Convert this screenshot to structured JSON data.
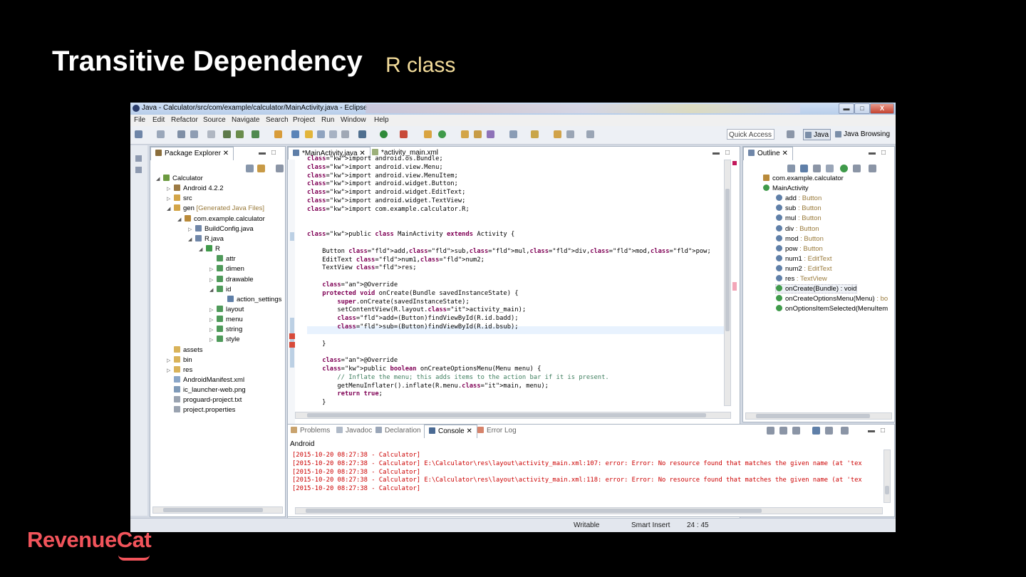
{
  "slide": {
    "title": "Transitive Dependency",
    "subtitle": "R class",
    "brand": "RevenueCat"
  },
  "window": {
    "title": "Java - Calculator/src/com/example/calculator/MainActivity.java - Eclipse",
    "buttons": {
      "minimize": "▬",
      "maximize": "□",
      "close": "X"
    }
  },
  "menu": [
    "File",
    "Edit",
    "Refactor",
    "Source",
    "Navigate",
    "Search",
    "Project",
    "Run",
    "Window",
    "Help"
  ],
  "toolbar": {
    "quick_access": "Quick Access",
    "perspectives": [
      "Java",
      "Java Browsing"
    ]
  },
  "package_explorer": {
    "tab": "Package Explorer",
    "items": [
      {
        "label": "Calculator",
        "icon": "project-icon"
      },
      {
        "label": "Android 4.2.2",
        "icon": "library-icon"
      },
      {
        "label": "src",
        "icon": "source-folder-icon"
      },
      {
        "label": "gen",
        "suffix": "[Generated Java Files]",
        "icon": "source-folder-icon"
      },
      {
        "label": "com.example.calculator",
        "icon": "package-icon"
      },
      {
        "label": "BuildConfig.java",
        "icon": "java-file-icon"
      },
      {
        "label": "R.java",
        "icon": "java-file-icon"
      },
      {
        "label": "R",
        "icon": "class-icon"
      },
      {
        "label": "attr",
        "icon": "inner-class-icon"
      },
      {
        "label": "dimen",
        "icon": "inner-class-icon"
      },
      {
        "label": "drawable",
        "icon": "inner-class-icon"
      },
      {
        "label": "id",
        "icon": "inner-class-icon"
      },
      {
        "label": "action_settings",
        "icon": "field-icon"
      },
      {
        "label": "layout",
        "icon": "inner-class-icon"
      },
      {
        "label": "menu",
        "icon": "inner-class-icon"
      },
      {
        "label": "string",
        "icon": "inner-class-icon"
      },
      {
        "label": "style",
        "icon": "inner-class-icon"
      },
      {
        "label": "assets",
        "icon": "folder-icon"
      },
      {
        "label": "bin",
        "icon": "folder-icon"
      },
      {
        "label": "res",
        "icon": "folder-icon"
      },
      {
        "label": "AndroidManifest.xml",
        "icon": "xml-file-icon"
      },
      {
        "label": "ic_launcher-web.png",
        "icon": "image-file-icon"
      },
      {
        "label": "proguard-project.txt",
        "icon": "text-file-icon"
      },
      {
        "label": "project.properties",
        "icon": "text-file-icon"
      }
    ]
  },
  "editor": {
    "tabs": [
      "*MainActivity.java",
      "*activity_main.xml"
    ],
    "lines": [
      "import android.os.Bundle;",
      "import android.view.Menu;",
      "import android.view.MenuItem;",
      "import android.widget.Button;",
      "import android.widget.EditText;",
      "import android.widget.TextView;",
      "import com.example.calculator.R;",
      "",
      "",
      "public class MainActivity extends Activity {",
      "",
      "    Button add,sub,mul,div,mod,pow;",
      "    EditText num1,num2;",
      "    TextView res;",
      "",
      "    @Override",
      "    protected void onCreate(Bundle savedInstanceState) {",
      "        super.onCreate(savedInstanceState);",
      "        setContentView(R.layout.activity_main);",
      "        add=(Button)findViewById(R.id.badd);",
      "        sub=(Button)findViewById(R.id.bsub);",
      "",
      "    }",
      "",
      "    @Override",
      "    public boolean onCreateOptionsMenu(Menu menu) {",
      "        // Inflate the menu; this adds items to the action bar if it is present.",
      "        getMenuInflater().inflate(R.menu.main, menu);",
      "        return true;",
      "    }"
    ]
  },
  "outline": {
    "tab": "Outline",
    "items": [
      {
        "name": "com.example.calculator",
        "type": ""
      },
      {
        "name": "MainActivity",
        "type": ""
      },
      {
        "name": "add",
        "type": " : Button"
      },
      {
        "name": "sub",
        "type": " : Button"
      },
      {
        "name": "mul",
        "type": " : Button"
      },
      {
        "name": "div",
        "type": " : Button"
      },
      {
        "name": "mod",
        "type": " : Button"
      },
      {
        "name": "pow",
        "type": " : Button"
      },
      {
        "name": "num1",
        "type": " : EditText"
      },
      {
        "name": "num2",
        "type": " : EditText"
      },
      {
        "name": "res",
        "type": " : TextView"
      },
      {
        "name": "onCreate(Bundle) : void",
        "type": ""
      },
      {
        "name": "onCreateOptionsMenu(Menu)",
        "type": " : bo"
      },
      {
        "name": "onOptionsItemSelected(MenuItem",
        "type": ""
      }
    ]
  },
  "bottom": {
    "tabs": [
      "Problems",
      "Javadoc",
      "Declaration",
      "Console",
      "Error Log"
    ],
    "console_label": "Android",
    "lines": [
      "[2015-10-20 08:27:38 - Calculator]",
      "[2015-10-20 08:27:38 - Calculator] E:\\Calculator\\res\\layout\\activity_main.xml:107: error: Error: No resource found that matches the given name (at 'tex",
      "[2015-10-20 08:27:38 - Calculator]",
      "[2015-10-20 08:27:38 - Calculator] E:\\Calculator\\res\\layout\\activity_main.xml:118: error: Error: No resource found that matches the given name (at 'tex",
      "[2015-10-20 08:27:38 - Calculator]"
    ]
  },
  "status": {
    "writable": "Writable",
    "insert": "Smart Insert",
    "position": "24 : 45"
  },
  "colors": {
    "brand": "#f2545b",
    "subtitle": "#f3dc9a",
    "keyword": "#7f0055",
    "error": "#cc0000"
  }
}
